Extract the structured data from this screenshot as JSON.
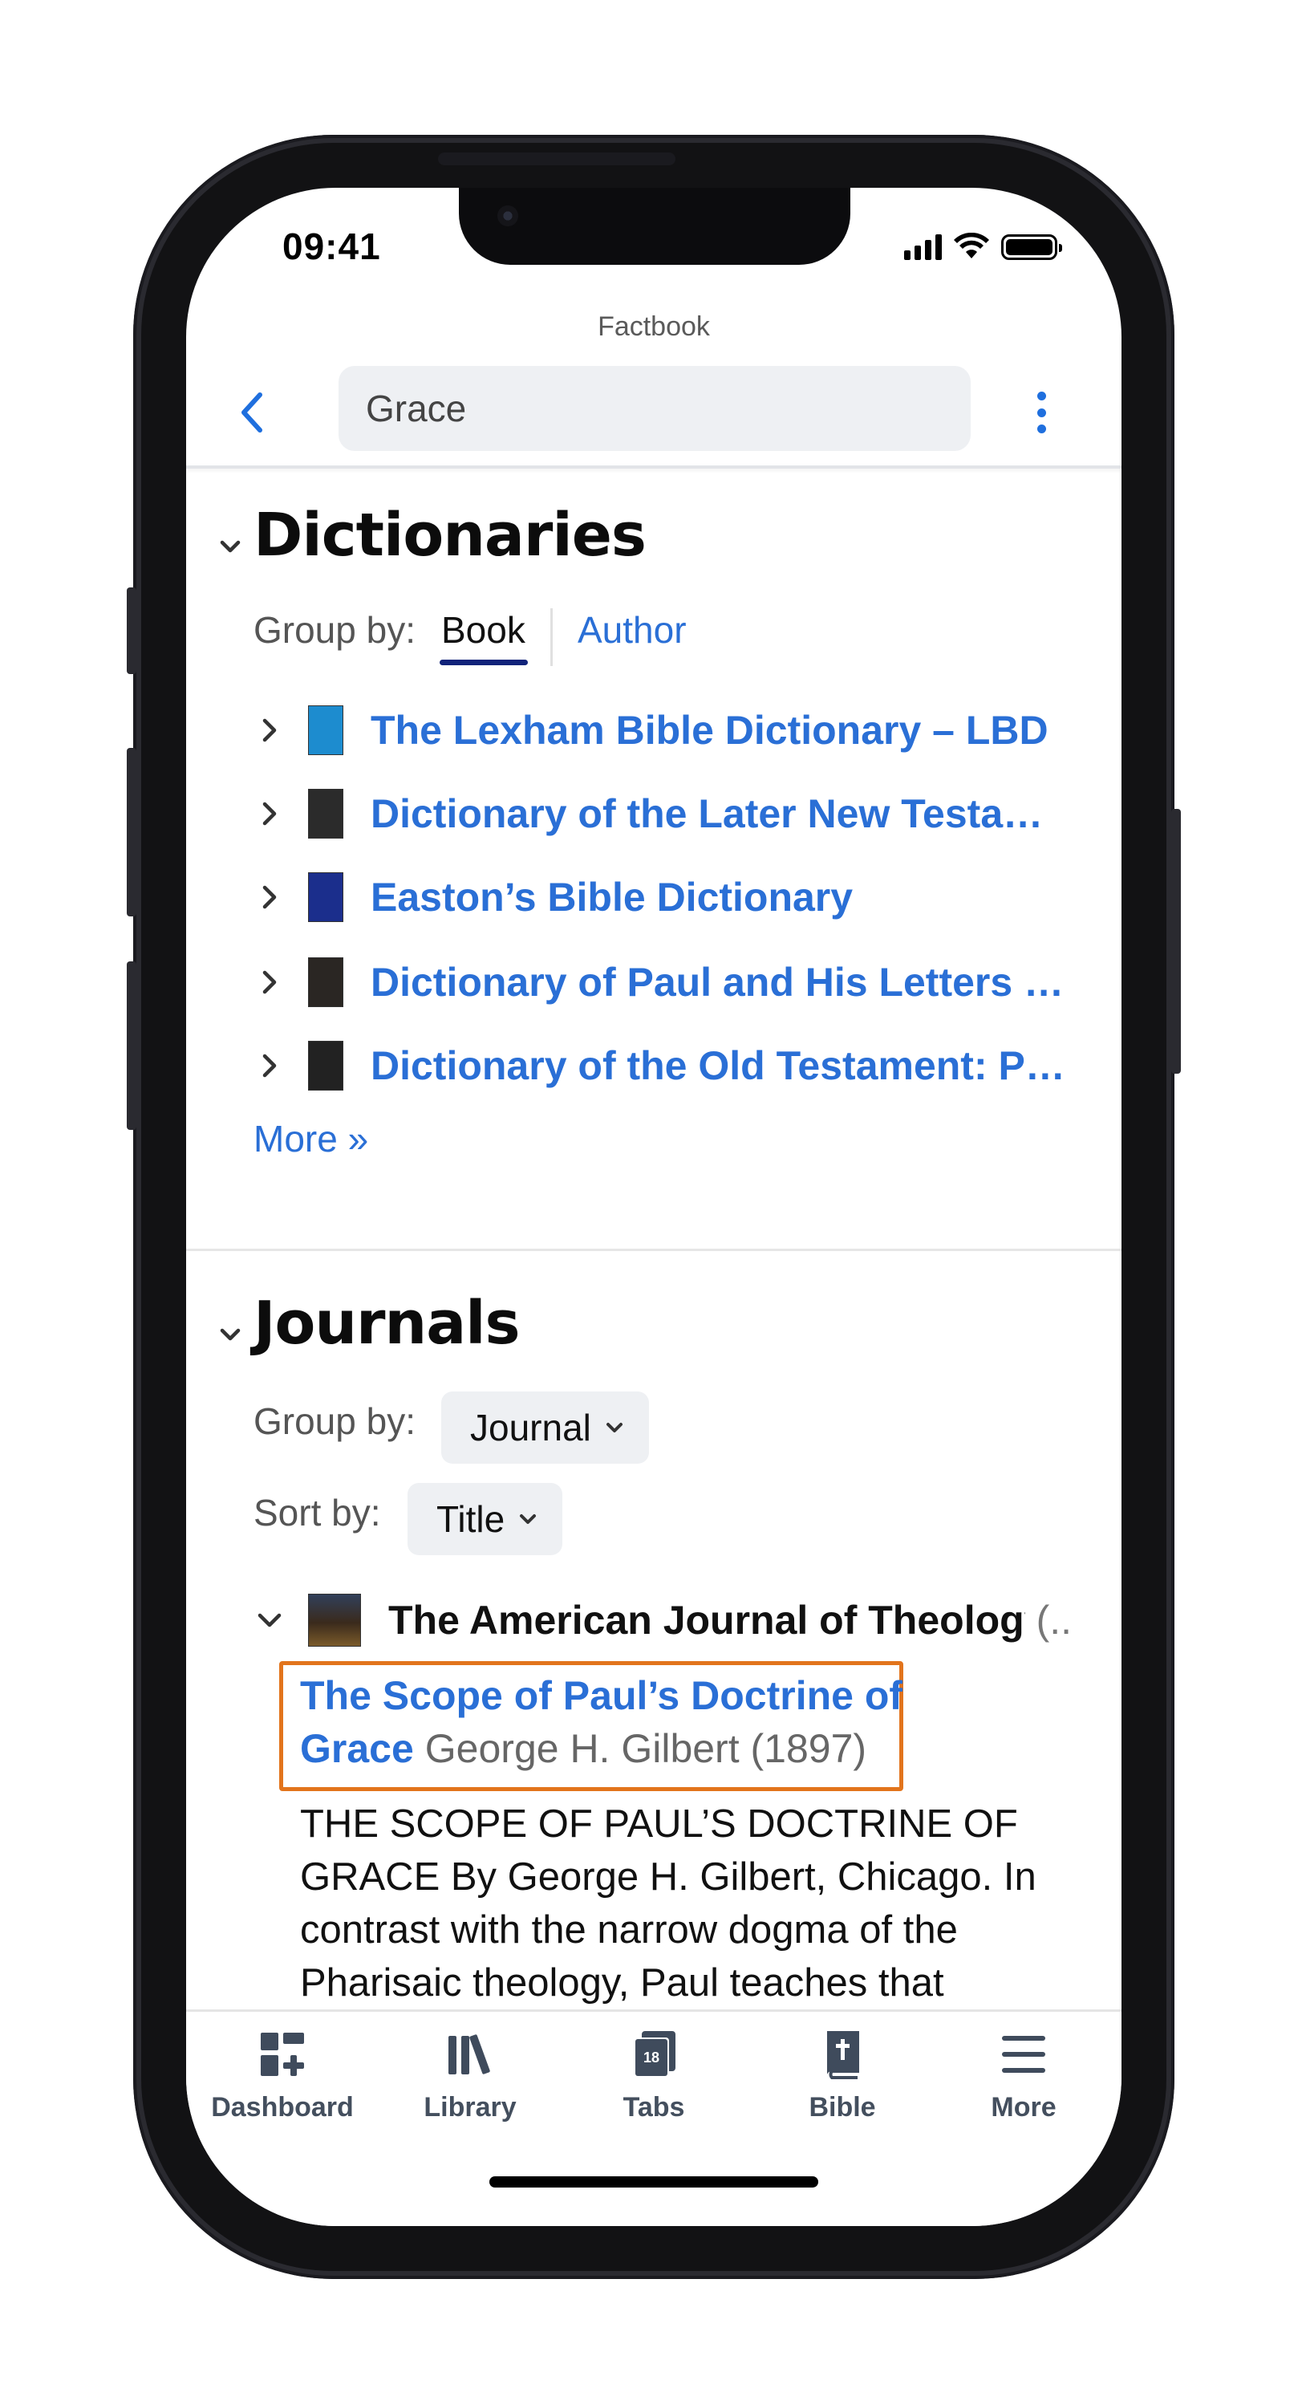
{
  "status_bar": {
    "time": "09:41"
  },
  "header": {
    "app_title": "Factbook",
    "search_value": "Grace"
  },
  "dictionaries": {
    "title": "Dictionaries",
    "group_by_label": "Group by:",
    "tabs": [
      "Book",
      "Author"
    ],
    "books": [
      {
        "title": "The Lexham Bible Dictionary – LBD",
        "cover_color": "#1d8ccf"
      },
      {
        "title": "Dictionary of the Later New Testa…",
        "cover_color": "#2b2b2b"
      },
      {
        "title": "Easton’s Bible Dictionary",
        "cover_color": "#1b2e8c"
      },
      {
        "title": "Dictionary of Paul and His Letters …",
        "cover_color": "#2a2623"
      },
      {
        "title": "Dictionary of the Old Testament: P…",
        "cover_color": "#222222"
      }
    ],
    "more_label": "More »"
  },
  "journals": {
    "title": "Journals",
    "group_by_label": "Group by:",
    "group_by_value": "Journal",
    "sort_by_label": "Sort by:",
    "sort_by_value": "Title",
    "journal_title": "The American Journal of Theology",
    "journal_rest": "(..",
    "article": {
      "title_line1": "The Scope of Paul’s Doctrine of",
      "title_line2": "Grace",
      "meta": "George H. Gilbert (1897)"
    },
    "excerpt": "THE SCOPE OF PAUL’S DOCTRINE OF GRACE By George H. Gilbert, Chicago. In contrast with the narrow dogma of the Pharisaic theology, Paul teaches that"
  },
  "tabbar": {
    "items": [
      {
        "label": "Dashboard",
        "icon": "dashboard-icon"
      },
      {
        "label": "Library",
        "icon": "library-icon"
      },
      {
        "label": "Tabs",
        "icon": "tabs-icon",
        "badge": "18"
      },
      {
        "label": "Bible",
        "icon": "bible-icon"
      },
      {
        "label": "More",
        "icon": "menu-icon"
      }
    ]
  },
  "colors": {
    "link": "#2a6fd6",
    "highlight": "#e2741c",
    "tab_underline": "#10237a"
  }
}
